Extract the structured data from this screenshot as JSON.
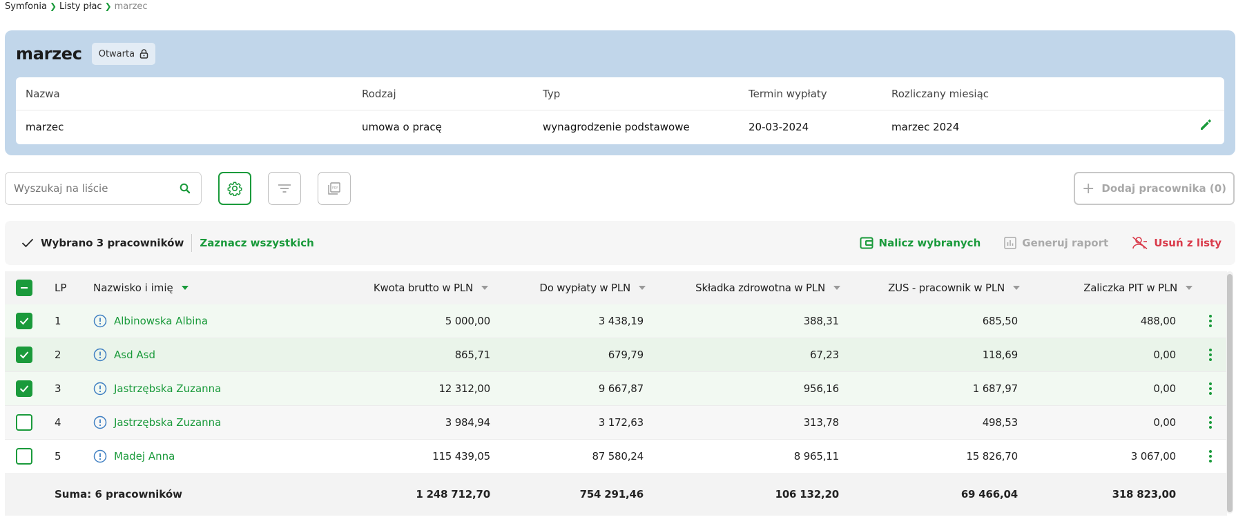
{
  "breadcrumb": [
    "Symfonia",
    "Listy płac",
    "marzec"
  ],
  "header": {
    "title": "marzec",
    "status": "Otwarta",
    "info": {
      "columns": [
        "Nazwa",
        "Rodzaj",
        "Typ",
        "Termin wypłaty",
        "Rozliczany miesiąc"
      ],
      "values": [
        "marzec",
        "umowa o pracę",
        "wynagrodzenie podstawowe",
        "20-03-2024",
        "marzec 2024"
      ]
    }
  },
  "toolbar": {
    "search_placeholder": "Wyszukaj na liście",
    "add_employee_label": "Dodaj pracownika (0)"
  },
  "selection": {
    "count_label": "Wybrano 3 pracowników",
    "select_all_label": "Zaznacz wszystkich",
    "actions": {
      "calculate": "Nalicz wybranych",
      "report": "Generuj raport",
      "remove": "Usuń z listy"
    }
  },
  "table": {
    "columns": {
      "lp": "LP",
      "name": "Nazwisko i imię",
      "gross": "Kwota brutto w PLN",
      "net": "Do wypłaty w PLN",
      "health": "Składka zdrowotna w PLN",
      "zus": "ZUS - pracownik w PLN",
      "pit": "Zaliczka PIT w PLN"
    },
    "rows": [
      {
        "lp": "1",
        "name": "Albinowska Albina",
        "gross": "5 000,00",
        "net": "3 438,19",
        "health": "388,31",
        "zus": "685,50",
        "pit": "488,00",
        "checked": true
      },
      {
        "lp": "2",
        "name": "Asd Asd",
        "gross": "865,71",
        "net": "679,79",
        "health": "67,23",
        "zus": "118,69",
        "pit": "0,00",
        "checked": true
      },
      {
        "lp": "3",
        "name": "Jastrzębska Zuzanna",
        "gross": "12 312,00",
        "net": "9 667,87",
        "health": "956,16",
        "zus": "1 687,97",
        "pit": "0,00",
        "checked": true
      },
      {
        "lp": "4",
        "name": "Jastrzębska Zuzanna",
        "gross": "3 984,94",
        "net": "3 172,63",
        "health": "313,78",
        "zus": "498,53",
        "pit": "0,00",
        "checked": false
      },
      {
        "lp": "5",
        "name": "Madej Anna",
        "gross": "115 439,05",
        "net": "87 580,24",
        "health": "8 965,11",
        "zus": "15 826,70",
        "pit": "3 067,00",
        "checked": false
      }
    ],
    "footer": {
      "label": "Suma:",
      "count": "6 pracowników",
      "gross": "1 248 712,70",
      "net": "754 291,46",
      "health": "106 132,20",
      "zus": "69 466,04",
      "pit": "318 823,00"
    }
  },
  "colors": {
    "accent": "#1a9a3b",
    "header_bg": "#c1d6ea",
    "danger": "#d93a4a",
    "info_icon": "#3f7fc2"
  },
  "icons": [
    "chevron-right-icon",
    "lock-icon",
    "pencil-icon",
    "search-icon",
    "gear-icon",
    "filter-icon",
    "pdf-icon",
    "plus-icon",
    "check-icon",
    "wallet-icon",
    "chart-icon",
    "user-remove-icon",
    "info-icon",
    "kebab-icon"
  ]
}
